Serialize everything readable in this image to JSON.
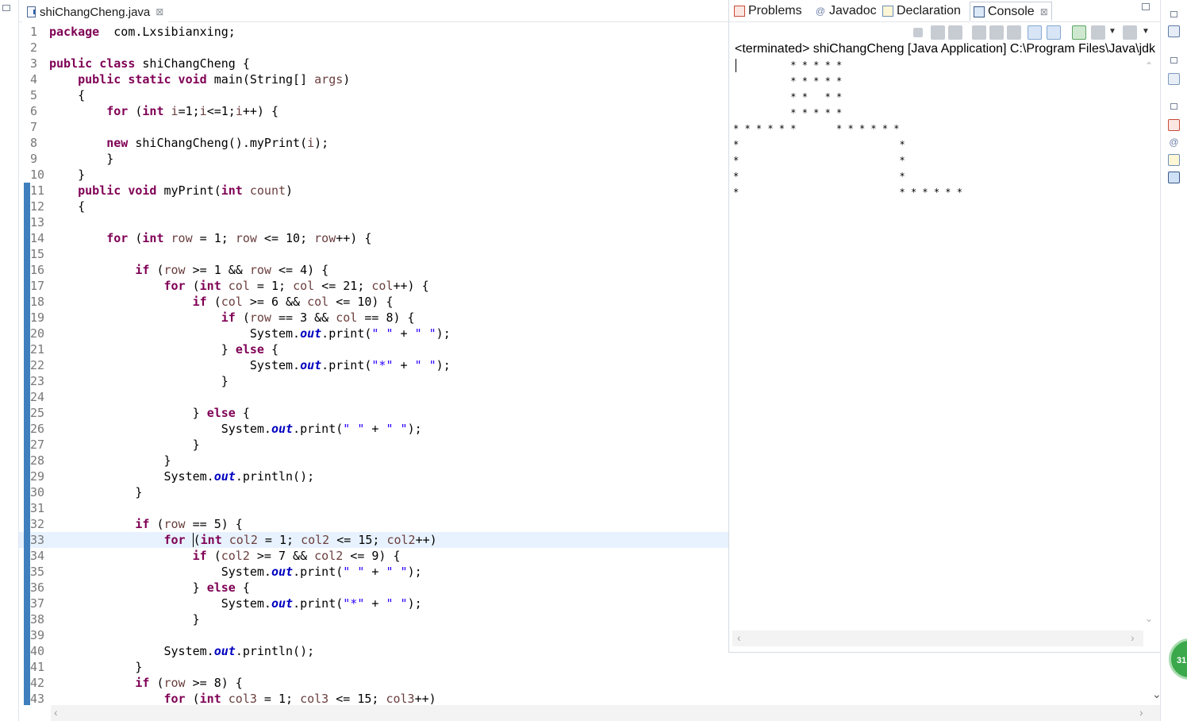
{
  "editor": {
    "tab_title": "shiChangCheng.java",
    "close_glyph": "⊠",
    "current_line": 33,
    "lines": [
      {
        "n": "1",
        "tokens": [
          [
            "kw",
            "package"
          ],
          [
            "",
            "  com.Lxsibianxing;"
          ]
        ]
      },
      {
        "n": "2",
        "tokens": []
      },
      {
        "n": "3",
        "tokens": [
          [
            "kw",
            "public class"
          ],
          [
            "",
            " shiChangCheng {"
          ]
        ]
      },
      {
        "n": "4",
        "tokens": [
          [
            "",
            "    "
          ],
          [
            "kw",
            "public static void"
          ],
          [
            "",
            " main(String[] "
          ],
          [
            "vr",
            "args"
          ],
          [
            "",
            ")"
          ]
        ]
      },
      {
        "n": "5",
        "tokens": [
          [
            "",
            "    {"
          ]
        ]
      },
      {
        "n": "6",
        "tokens": [
          [
            "",
            "        "
          ],
          [
            "kw",
            "for"
          ],
          [
            "",
            " ("
          ],
          [
            "kw",
            "int"
          ],
          [
            "",
            " "
          ],
          [
            "vr",
            "i"
          ],
          [
            "",
            "=1;"
          ],
          [
            "vr",
            "i"
          ],
          [
            "",
            "<=1;"
          ],
          [
            "vr",
            "i"
          ],
          [
            "",
            "++) {"
          ]
        ]
      },
      {
        "n": "7",
        "tokens": []
      },
      {
        "n": "8",
        "tokens": [
          [
            "",
            "        "
          ],
          [
            "kw",
            "new"
          ],
          [
            "",
            " shiChangCheng().myPrint("
          ],
          [
            "vr",
            "i"
          ],
          [
            "",
            ");"
          ]
        ]
      },
      {
        "n": "9",
        "tokens": [
          [
            "",
            "        }"
          ]
        ]
      },
      {
        "n": "10",
        "tokens": [
          [
            "",
            "    }"
          ]
        ]
      },
      {
        "n": "11",
        "tokens": [
          [
            "",
            "    "
          ],
          [
            "kw",
            "public void"
          ],
          [
            "",
            " myPrint("
          ],
          [
            "kw",
            "int"
          ],
          [
            "",
            " "
          ],
          [
            "vr",
            "count"
          ],
          [
            "",
            ")"
          ]
        ],
        "bar": true
      },
      {
        "n": "12",
        "tokens": [
          [
            "",
            "    {"
          ]
        ],
        "bar": true
      },
      {
        "n": "13",
        "tokens": [],
        "bar": true
      },
      {
        "n": "14",
        "tokens": [
          [
            "",
            "        "
          ],
          [
            "kw",
            "for"
          ],
          [
            "",
            " ("
          ],
          [
            "kw",
            "int"
          ],
          [
            "",
            " "
          ],
          [
            "vr",
            "row"
          ],
          [
            "",
            " = 1; "
          ],
          [
            "vr",
            "row"
          ],
          [
            "",
            " <= 10; "
          ],
          [
            "vr",
            "row"
          ],
          [
            "",
            "++) {"
          ]
        ],
        "bar": true
      },
      {
        "n": "15",
        "tokens": [],
        "bar": true
      },
      {
        "n": "16",
        "tokens": [
          [
            "",
            "            "
          ],
          [
            "kw",
            "if"
          ],
          [
            "",
            " ("
          ],
          [
            "vr",
            "row"
          ],
          [
            "",
            " >= 1 && "
          ],
          [
            "vr",
            "row"
          ],
          [
            "",
            " <= 4) {"
          ]
        ],
        "bar": true
      },
      {
        "n": "17",
        "tokens": [
          [
            "",
            "                "
          ],
          [
            "kw",
            "for"
          ],
          [
            "",
            " ("
          ],
          [
            "kw",
            "int"
          ],
          [
            "",
            " "
          ],
          [
            "vr",
            "col"
          ],
          [
            "",
            " = 1; "
          ],
          [
            "vr",
            "col"
          ],
          [
            "",
            " <= 21; "
          ],
          [
            "vr",
            "col"
          ],
          [
            "",
            "++) {"
          ]
        ],
        "bar": true
      },
      {
        "n": "18",
        "tokens": [
          [
            "",
            "                    "
          ],
          [
            "kw",
            "if"
          ],
          [
            "",
            " ("
          ],
          [
            "vr",
            "col"
          ],
          [
            "",
            " >= 6 && "
          ],
          [
            "vr",
            "col"
          ],
          [
            "",
            " <= 10) {"
          ]
        ],
        "bar": true
      },
      {
        "n": "19",
        "tokens": [
          [
            "",
            "                        "
          ],
          [
            "kw",
            "if"
          ],
          [
            "",
            " ("
          ],
          [
            "vr",
            "row"
          ],
          [
            "",
            " == 3 && "
          ],
          [
            "vr",
            "col"
          ],
          [
            "",
            " == 8) {"
          ]
        ],
        "bar": true
      },
      {
        "n": "20",
        "tokens": [
          [
            "",
            "                            System."
          ],
          [
            "fld",
            "out"
          ],
          [
            "",
            ".print("
          ],
          [
            "st",
            "\" \""
          ],
          [
            "",
            " + "
          ],
          [
            "st",
            "\" \""
          ],
          [
            "",
            ");"
          ]
        ],
        "bar": true
      },
      {
        "n": "21",
        "tokens": [
          [
            "",
            "                        } "
          ],
          [
            "kw",
            "else"
          ],
          [
            "",
            " {"
          ]
        ],
        "bar": true
      },
      {
        "n": "22",
        "tokens": [
          [
            "",
            "                            System."
          ],
          [
            "fld",
            "out"
          ],
          [
            "",
            ".print("
          ],
          [
            "st",
            "\"*\""
          ],
          [
            "",
            " + "
          ],
          [
            "st",
            "\" \""
          ],
          [
            "",
            ");"
          ]
        ],
        "bar": true
      },
      {
        "n": "23",
        "tokens": [
          [
            "",
            "                        }"
          ]
        ],
        "bar": true
      },
      {
        "n": "24",
        "tokens": [],
        "bar": true
      },
      {
        "n": "25",
        "tokens": [
          [
            "",
            "                    } "
          ],
          [
            "kw",
            "else"
          ],
          [
            "",
            " {"
          ]
        ],
        "bar": true
      },
      {
        "n": "26",
        "tokens": [
          [
            "",
            "                        System."
          ],
          [
            "fld",
            "out"
          ],
          [
            "",
            ".print("
          ],
          [
            "st",
            "\" \""
          ],
          [
            "",
            " + "
          ],
          [
            "st",
            "\" \""
          ],
          [
            "",
            ");"
          ]
        ],
        "bar": true
      },
      {
        "n": "27",
        "tokens": [
          [
            "",
            "                    }"
          ]
        ],
        "bar": true
      },
      {
        "n": "28",
        "tokens": [
          [
            "",
            "                }"
          ]
        ],
        "bar": true
      },
      {
        "n": "29",
        "tokens": [
          [
            "",
            "                System."
          ],
          [
            "fld",
            "out"
          ],
          [
            "",
            ".println();"
          ]
        ],
        "bar": true
      },
      {
        "n": "30",
        "tokens": [
          [
            "",
            "            }"
          ]
        ],
        "bar": true
      },
      {
        "n": "31",
        "tokens": [],
        "bar": true
      },
      {
        "n": "32",
        "tokens": [
          [
            "",
            "            "
          ],
          [
            "kw",
            "if"
          ],
          [
            "",
            " ("
          ],
          [
            "vr",
            "row"
          ],
          [
            "",
            " == 5) {"
          ]
        ],
        "bar": true
      },
      {
        "n": "33",
        "tokens": [
          [
            "",
            "                "
          ],
          [
            "kw",
            "for"
          ],
          [
            "",
            " "
          ],
          [
            "caret",
            "("
          ],
          [
            "kw",
            "int"
          ],
          [
            "",
            " "
          ],
          [
            "vr",
            "col2"
          ],
          [
            "",
            " = 1; "
          ],
          [
            "vr",
            "col2"
          ],
          [
            "",
            " <= 15; "
          ],
          [
            "vr",
            "col2"
          ],
          [
            "",
            "++)"
          ]
        ],
        "bar": true
      },
      {
        "n": "34",
        "tokens": [
          [
            "",
            "                    "
          ],
          [
            "kw",
            "if"
          ],
          [
            "",
            " ("
          ],
          [
            "vr",
            "col2"
          ],
          [
            "",
            " >= 7 && "
          ],
          [
            "vr",
            "col2"
          ],
          [
            "",
            " <= 9) {"
          ]
        ],
        "bar": true
      },
      {
        "n": "35",
        "tokens": [
          [
            "",
            "                        System."
          ],
          [
            "fld",
            "out"
          ],
          [
            "",
            ".print("
          ],
          [
            "st",
            "\" \""
          ],
          [
            "",
            " + "
          ],
          [
            "st",
            "\" \""
          ],
          [
            "",
            ");"
          ]
        ],
        "bar": true
      },
      {
        "n": "36",
        "tokens": [
          [
            "",
            "                    } "
          ],
          [
            "kw",
            "else"
          ],
          [
            "",
            " {"
          ]
        ],
        "bar": true
      },
      {
        "n": "37",
        "tokens": [
          [
            "",
            "                        System."
          ],
          [
            "fld",
            "out"
          ],
          [
            "",
            ".print("
          ],
          [
            "st",
            "\"*\""
          ],
          [
            "",
            " + "
          ],
          [
            "st",
            "\" \""
          ],
          [
            "",
            ");"
          ]
        ],
        "bar": true
      },
      {
        "n": "38",
        "tokens": [
          [
            "",
            "                    }"
          ]
        ],
        "bar": true
      },
      {
        "n": "39",
        "tokens": [],
        "bar": true
      },
      {
        "n": "40",
        "tokens": [
          [
            "",
            "                System."
          ],
          [
            "fld",
            "out"
          ],
          [
            "",
            ".println();"
          ]
        ],
        "bar": true
      },
      {
        "n": "41",
        "tokens": [
          [
            "",
            "            }"
          ]
        ],
        "bar": true
      },
      {
        "n": "42",
        "tokens": [
          [
            "",
            "            "
          ],
          [
            "kw",
            "if"
          ],
          [
            "",
            " ("
          ],
          [
            "vr",
            "row"
          ],
          [
            "",
            " >= 8) {"
          ]
        ],
        "bar": true
      },
      {
        "n": "43",
        "tokens": [
          [
            "",
            "                "
          ],
          [
            "kw",
            "for"
          ],
          [
            "",
            " ("
          ],
          [
            "kw",
            "int"
          ],
          [
            "",
            " "
          ],
          [
            "vr",
            "col3"
          ],
          [
            "",
            " = 1; "
          ],
          [
            "vr",
            "col3"
          ],
          [
            "",
            " <= 15; "
          ],
          [
            "vr",
            "col3"
          ],
          [
            "",
            "++)"
          ]
        ],
        "bar": true
      }
    ]
  },
  "views": {
    "tabs": [
      {
        "label": "Problems",
        "icon": "problems-icon"
      },
      {
        "label": "Javadoc",
        "icon": "javadoc-icon"
      },
      {
        "label": "Declaration",
        "icon": "declaration-icon"
      },
      {
        "label": "Console",
        "icon": "console-icon",
        "active": true
      }
    ],
    "close_glyph": "⊠"
  },
  "console": {
    "title": "<terminated> shiChangCheng [Java Application] C:\\Program Files\\Java\\jdk",
    "output": [
      "          * * * * *",
      "          * * * * *",
      "          * *   * *",
      "          * * * * *",
      "* * * * * *       * * * * * *",
      "*                            *",
      "*                            *",
      "*                            *",
      "*                            * * * * * *"
    ]
  },
  "badge": {
    "text": "31"
  },
  "colors": {
    "keyword": "#7f0055",
    "local_var": "#6a3e3e",
    "static_field": "#0000c0",
    "string": "#2a00ff",
    "current_line": "#e8f2fe",
    "change_bar": "#3f7fbd"
  }
}
